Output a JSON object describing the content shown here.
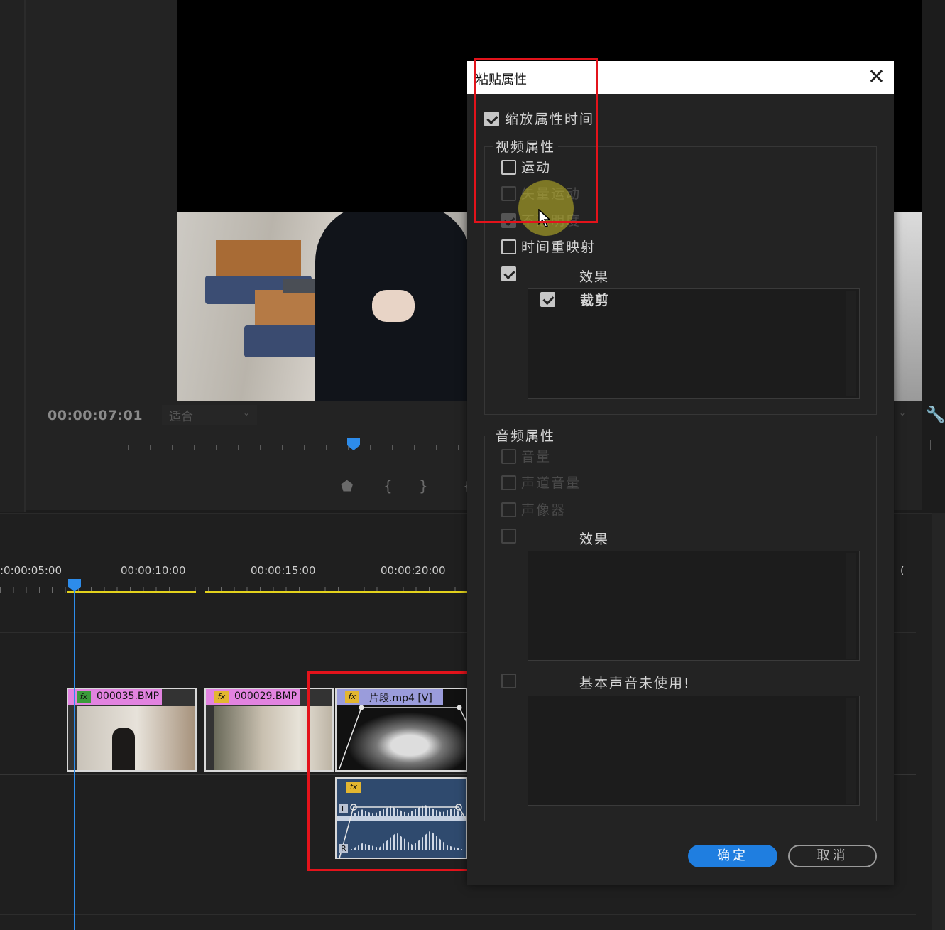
{
  "monitor": {
    "timecode": "00:00:07:01",
    "fit_select": "适合"
  },
  "timeline": {
    "ticks": [
      ":0:00:05:00",
      "00:00:10:00",
      "00:00:15:00",
      "00:00:20:00",
      "("
    ],
    "clips": [
      {
        "label": "000035.BMP",
        "fx": "fx"
      },
      {
        "label": "000029.BMP",
        "fx": "fx"
      },
      {
        "label": "片段.mp4 [V]",
        "fx": "fx"
      }
    ],
    "audio_clip": {
      "fx": "fx",
      "ch_left": "L",
      "ch_right": "R"
    }
  },
  "dialog": {
    "title": "粘贴属性",
    "close": "✕",
    "scale_time": {
      "label": "缩放属性时间",
      "checked": true
    },
    "video_group": {
      "title": "视频属性",
      "items": [
        {
          "label": "运动",
          "checked": false,
          "enabled": true
        },
        {
          "label": "失量运动",
          "checked": false,
          "enabled": false
        },
        {
          "label": "不透明度",
          "checked": true,
          "enabled": false
        },
        {
          "label": "时间重映射",
          "checked": false,
          "enabled": true
        }
      ],
      "effects_label": "效果",
      "effects_checked": true,
      "effects_list": [
        {
          "label": "裁剪",
          "checked": true
        }
      ]
    },
    "audio_group": {
      "title": "音频属性",
      "items": [
        {
          "label": "音量",
          "checked": false,
          "enabled": false
        },
        {
          "label": "声道音量",
          "checked": false,
          "enabled": false
        },
        {
          "label": "声像器",
          "checked": false,
          "enabled": false
        }
      ],
      "effects_label": "效果",
      "essential_label": "基本声音未使用!"
    },
    "ok_label": "确定",
    "cancel_label": "取消"
  }
}
